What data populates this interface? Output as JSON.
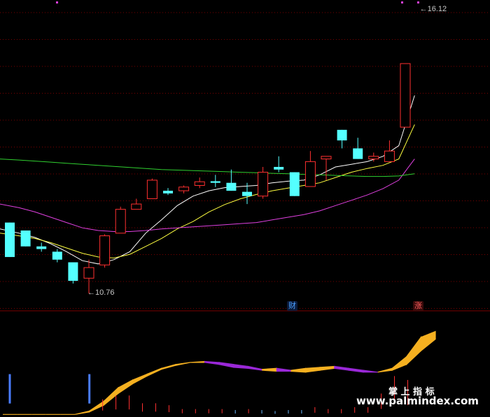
{
  "chart_data": [
    {
      "type": "candlestick",
      "ylim": [
        10.5,
        16.3
      ],
      "colors": {
        "up": "#ff3030",
        "down": "#54ffff",
        "bg": "#000000",
        "grid": "#7a0000"
      },
      "candles": [
        {
          "o": 12.1,
          "h": 12.1,
          "l": 11.45,
          "c": 11.45
        },
        {
          "o": 11.95,
          "h": 11.95,
          "l": 11.65,
          "c": 11.65
        },
        {
          "o": 11.65,
          "h": 11.72,
          "l": 11.55,
          "c": 11.6
        },
        {
          "o": 11.55,
          "h": 11.6,
          "l": 11.35,
          "c": 11.4
        },
        {
          "o": 11.35,
          "h": 11.35,
          "l": 10.95,
          "c": 11.0
        },
        {
          "o": 11.05,
          "h": 11.4,
          "l": 10.76,
          "c": 11.25
        },
        {
          "o": 11.3,
          "h": 11.88,
          "l": 11.25,
          "c": 11.85
        },
        {
          "o": 11.9,
          "h": 12.4,
          "l": 11.9,
          "c": 12.35
        },
        {
          "o": 12.35,
          "h": 12.55,
          "l": 12.35,
          "c": 12.45
        },
        {
          "o": 12.55,
          "h": 12.93,
          "l": 12.55,
          "c": 12.9
        },
        {
          "o": 12.7,
          "h": 12.75,
          "l": 12.62,
          "c": 12.65
        },
        {
          "o": 12.7,
          "h": 12.8,
          "l": 12.65,
          "c": 12.77
        },
        {
          "o": 12.8,
          "h": 12.95,
          "l": 12.75,
          "c": 12.87
        },
        {
          "o": 12.88,
          "h": 13.0,
          "l": 12.77,
          "c": 12.85
        },
        {
          "o": 12.85,
          "h": 13.1,
          "l": 12.7,
          "c": 12.7
        },
        {
          "o": 12.68,
          "h": 12.85,
          "l": 12.45,
          "c": 12.6
        },
        {
          "o": 12.6,
          "h": 13.15,
          "l": 12.55,
          "c": 13.05
        },
        {
          "o": 13.15,
          "h": 13.35,
          "l": 13.05,
          "c": 13.1
        },
        {
          "o": 13.05,
          "h": 13.05,
          "l": 12.6,
          "c": 12.6
        },
        {
          "o": 12.78,
          "h": 13.45,
          "l": 12.78,
          "c": 13.25
        },
        {
          "o": 13.3,
          "h": 13.35,
          "l": 12.9,
          "c": 13.35
        },
        {
          "o": 13.85,
          "h": 13.85,
          "l": 13.5,
          "c": 13.65
        },
        {
          "o": 13.5,
          "h": 13.7,
          "l": 13.3,
          "c": 13.3
        },
        {
          "o": 13.3,
          "h": 13.42,
          "l": 13.25,
          "c": 13.35
        },
        {
          "o": 13.25,
          "h": 13.65,
          "l": 13.25,
          "c": 13.45
        },
        {
          "o": 13.9,
          "h": 15.1,
          "l": 13.9,
          "c": 15.1
        }
      ],
      "ma": [
        {
          "color": "#ffffff",
          "values": [
            11.98,
            11.9,
            11.82,
            11.7,
            11.55,
            11.38,
            11.32,
            11.4,
            11.55,
            11.9,
            12.15,
            12.42,
            12.6,
            12.7,
            12.76,
            12.78,
            12.8,
            12.85,
            12.88,
            12.9,
            13.0,
            13.15,
            13.2,
            13.25,
            13.35,
            13.55,
            14.5
          ]
        },
        {
          "color": "#ffff40",
          "values": [
            11.9,
            11.85,
            11.8,
            11.72,
            11.62,
            11.52,
            11.45,
            11.43,
            11.5,
            11.65,
            11.8,
            11.98,
            12.12,
            12.3,
            12.44,
            12.55,
            12.63,
            12.7,
            12.75,
            12.8,
            12.85,
            12.95,
            13.05,
            13.12,
            13.18,
            13.3,
            13.95
          ]
        },
        {
          "color": "#e040e0",
          "values": [
            12.45,
            12.38,
            12.3,
            12.2,
            12.1,
            12.0,
            11.95,
            11.93,
            11.93,
            11.95,
            11.98,
            12.0,
            12.02,
            12.04,
            12.06,
            12.08,
            12.1,
            12.15,
            12.2,
            12.25,
            12.32,
            12.42,
            12.52,
            12.62,
            12.74,
            12.9,
            13.3
          ]
        },
        {
          "color": "#30d030",
          "values": [
            13.3,
            13.28,
            13.26,
            13.24,
            13.22,
            13.2,
            13.18,
            13.16,
            13.14,
            13.12,
            13.1,
            13.09,
            13.08,
            13.07,
            13.06,
            13.05,
            13.04,
            13.03,
            13.02,
            13.01,
            13.0,
            12.99,
            12.98,
            12.97,
            12.97,
            12.98,
            13.02
          ]
        }
      ],
      "annotations": [
        {
          "text": "←10.76",
          "candle": 5,
          "price": 10.76
        },
        {
          "text": "←16.12",
          "candle": 26,
          "price": 16.12
        }
      ]
    },
    {
      "type": "area",
      "ylim": [
        0,
        100
      ],
      "band": {
        "upper": [
          0.5,
          0.5,
          0.5,
          0.5,
          0.5,
          0.5,
          4,
          14,
          28,
          36,
          42,
          48,
          52,
          54,
          55,
          54,
          52,
          50,
          47,
          48,
          46,
          48,
          49,
          50,
          48,
          46,
          44,
          48,
          60,
          80,
          86
        ],
        "lower": [
          0.5,
          0.5,
          0.5,
          0.5,
          0.5,
          0.5,
          3,
          10,
          22,
          32,
          40,
          47,
          51,
          54,
          54,
          52,
          49,
          48,
          46,
          45,
          45,
          44,
          46,
          48,
          46,
          44,
          44,
          46,
          52,
          66,
          78
        ],
        "up_color": "#f5b020",
        "down_color": "#9a28d8"
      },
      "bars": [
        {
          "x": 0,
          "v": 42,
          "color": "#4a7dff"
        },
        {
          "x": 6,
          "v": 42,
          "color": "#4a7dff"
        },
        {
          "x": 7,
          "v": 16,
          "color": "#ff3030"
        },
        {
          "x": 8,
          "v": 20,
          "color": "#ff3030"
        },
        {
          "x": 9,
          "v": 20,
          "color": "#ff3030"
        },
        {
          "x": 10,
          "v": 12,
          "color": "#ff3030"
        },
        {
          "x": 11,
          "v": 12,
          "color": "#ff3030"
        },
        {
          "x": 12,
          "v": 10,
          "color": "#ff3030"
        },
        {
          "x": 13,
          "v": 6,
          "color": "#ff3030"
        },
        {
          "x": 14,
          "v": 6,
          "color": "#ff3030"
        },
        {
          "x": 15,
          "v": 6,
          "color": "#ff3030"
        },
        {
          "x": 16,
          "v": 6,
          "color": "#ff3030"
        },
        {
          "x": 17,
          "v": 5,
          "color": "#6ab8ff"
        },
        {
          "x": 18,
          "v": 6,
          "color": "#ff3030"
        },
        {
          "x": 19,
          "v": 5,
          "color": "#6ab8ff"
        },
        {
          "x": 20,
          "v": 4,
          "color": "#6ab8ff"
        },
        {
          "x": 21,
          "v": 5,
          "color": "#6ab8ff"
        },
        {
          "x": 22,
          "v": 5,
          "color": "#6ab8ff"
        },
        {
          "x": 23,
          "v": 8,
          "color": "#ff3030"
        },
        {
          "x": 24,
          "v": 6,
          "color": "#ff3030"
        },
        {
          "x": 25,
          "v": 6,
          "color": "#ff3030"
        },
        {
          "x": 26,
          "v": 8,
          "color": "#ff3030"
        },
        {
          "x": 27,
          "v": 8,
          "color": "#ff3030"
        },
        {
          "x": 28,
          "v": 22,
          "color": "#ff3030"
        },
        {
          "x": 29,
          "v": 40,
          "color": "#ff3030"
        },
        {
          "x": 30,
          "v": 36,
          "color": "#ff3030"
        }
      ]
    }
  ],
  "markers": {
    "cai": "财",
    "zhang": "涨"
  },
  "watermark": {
    "title": "掌 上 指 标",
    "url": "www.palmindex.com"
  }
}
